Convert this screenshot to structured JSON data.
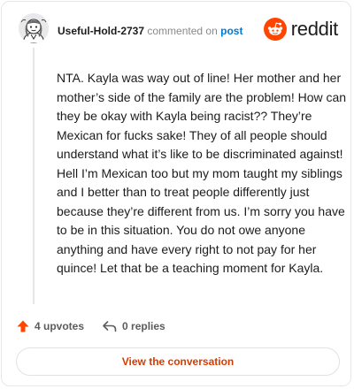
{
  "header": {
    "username": "Useful-Hold-2737",
    "action_text": "commented on",
    "post_link": "post",
    "avatar_icon": "snoo-avatar-icon"
  },
  "brand": {
    "logo_icon": "reddit-snoo-icon",
    "wordmark": "reddit",
    "accent_color": "#ff4500",
    "link_color": "#0079d3"
  },
  "comment": {
    "body": "NTA. Kayla was way out of line! Her mother and her mother’s side of the family are the problem! How can they be okay with Kayla being racist?? They’re Mexican for fucks sake! They of all people should understand what it’s like to be discriminated against! Hell I’m Mexican too but my mom taught my siblings and I better than to treat people differently just because they’re different from us. I’m sorry you have to be in this situation. You do not owe anyone anything and have every right to not pay for her quince! Let that be a teaching moment for Kayla."
  },
  "actions": {
    "upvotes_label": "4 upvotes",
    "upvote_icon": "upvote-arrow-icon",
    "replies_label": "0 replies",
    "reply_icon": "reply-arrow-icon"
  },
  "cta": {
    "label": "View the conversation",
    "color": "#d93a00"
  }
}
